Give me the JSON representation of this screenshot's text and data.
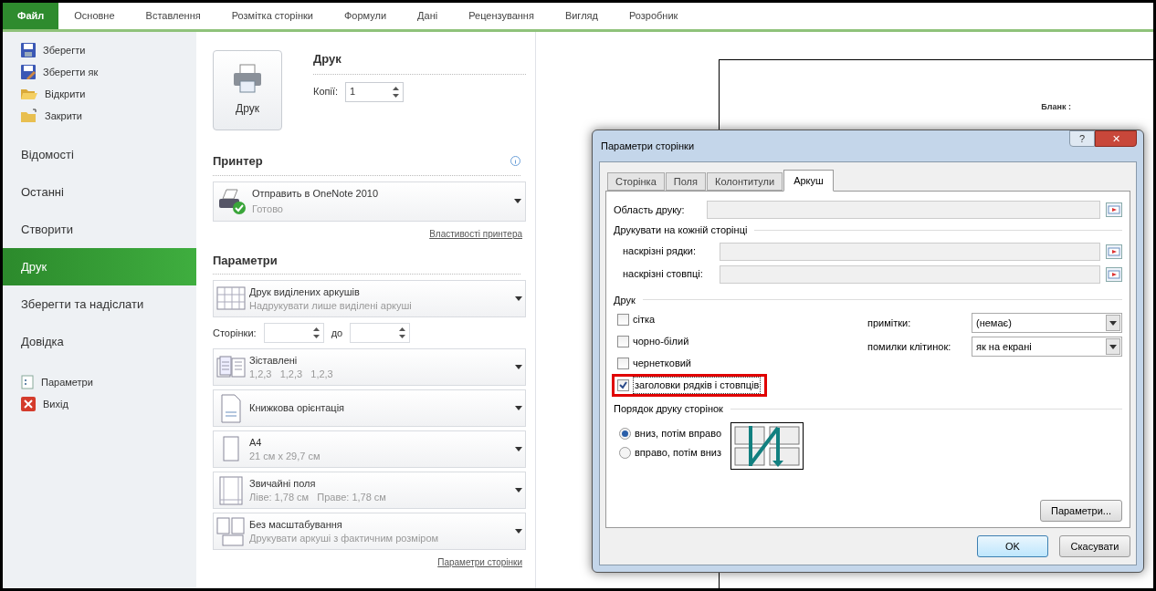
{
  "ribbon_tabs": [
    {
      "label": "Файл",
      "selected": true
    },
    {
      "label": "Основне",
      "selected": false
    },
    {
      "label": "Вставлення",
      "selected": false
    },
    {
      "label": "Розмітка сторінки",
      "selected": false
    },
    {
      "label": "Формули",
      "selected": false
    },
    {
      "label": "Дані",
      "selected": false
    },
    {
      "label": "Рецензування",
      "selected": false
    },
    {
      "label": "Вигляд",
      "selected": false
    },
    {
      "label": "Розробник",
      "selected": false
    }
  ],
  "sidebar": {
    "items": [
      {
        "label": "Зберегти",
        "kind": "command",
        "selected": false
      },
      {
        "label": "Зберегти як",
        "kind": "command",
        "selected": false
      },
      {
        "label": "Відкрити",
        "kind": "command",
        "selected": false
      },
      {
        "label": "Закрити",
        "kind": "command",
        "selected": false
      },
      {
        "label": "Відомості",
        "kind": "section",
        "selected": false
      },
      {
        "label": "Останні",
        "kind": "section",
        "selected": false
      },
      {
        "label": "Створити",
        "kind": "section",
        "selected": false
      },
      {
        "label": "Друк",
        "kind": "section",
        "selected": true
      },
      {
        "label": "Зберегти та надіслати",
        "kind": "section",
        "selected": false
      },
      {
        "label": "Довідка",
        "kind": "section",
        "selected": false
      },
      {
        "label": "Параметри",
        "kind": "command",
        "selected": false
      },
      {
        "label": "Вихід",
        "kind": "command",
        "selected": false
      }
    ]
  },
  "print_panel": {
    "print_button": "Друк",
    "heading": "Друк",
    "copies_label": "Копії:",
    "copies_value": "1",
    "printer_heading": "Принтер",
    "printer_name": "Отправить в OneNote 2010",
    "printer_status": "Готово",
    "printer_properties": "Властивості принтера",
    "settings_heading": "Параметри",
    "settings": [
      {
        "kind": "dropdown",
        "title": "Друк виділених аркушів",
        "subtitle": "Надрукувати лише виділені аркуші"
      },
      {
        "kind": "pages",
        "label": "Сторінки:",
        "to_label": "до"
      },
      {
        "kind": "dropdown",
        "title": "Зіставлені",
        "subtitle": "1,2,3   1,2,3   1,2,3"
      },
      {
        "kind": "dropdown",
        "title": "Книжкова орієнтація"
      },
      {
        "kind": "dropdown",
        "title": "A4",
        "subtitle": "21 см x 29,7 см"
      },
      {
        "kind": "dropdown",
        "title": "Звичайні поля",
        "subtitle": "Ліве: 1,78 см   Праве: 1,78 см"
      },
      {
        "kind": "dropdown",
        "title": "Без масштабування",
        "subtitle": "Друкувати аркуші з фактичним розміром"
      }
    ],
    "page_setup_link": "Параметри сторінки"
  },
  "preview": {
    "text": "Бланк :"
  },
  "dialog": {
    "title": "Параметри сторінки",
    "help": "?",
    "close": "✕",
    "tabs": [
      {
        "label": "Сторінка",
        "selected": false
      },
      {
        "label": "Поля",
        "selected": false
      },
      {
        "label": "Колонтитули",
        "selected": false
      },
      {
        "label": "Аркуш",
        "selected": true
      }
    ],
    "print_area_label": "Область друку:",
    "repeat_heading": "Друкувати на кожній сторінці",
    "rows_label": "наскрізні рядки:",
    "cols_label": "наскрізні стовпці:",
    "print_heading": "Друк",
    "checkboxes": [
      {
        "label": "сітка",
        "checked": false,
        "highlighted": false
      },
      {
        "label": "чорно-білий",
        "checked": false,
        "highlighted": false
      },
      {
        "label": "чернетковий",
        "checked": false,
        "highlighted": false
      },
      {
        "label": "заголовки рядків і стовпців",
        "checked": true,
        "highlighted": true
      }
    ],
    "comments_label": "примітки:",
    "comments_value": "(немає)",
    "errors_label": "помилки клітинок:",
    "errors_value": "як на екрані",
    "order_heading": "Порядок друку сторінок",
    "radios": [
      {
        "label": "вниз, потім вправо",
        "selected": true
      },
      {
        "label": "вправо, потім вниз",
        "selected": false
      }
    ],
    "options_button": "Параметри...",
    "ok": "OK",
    "cancel": "Скасувати"
  }
}
